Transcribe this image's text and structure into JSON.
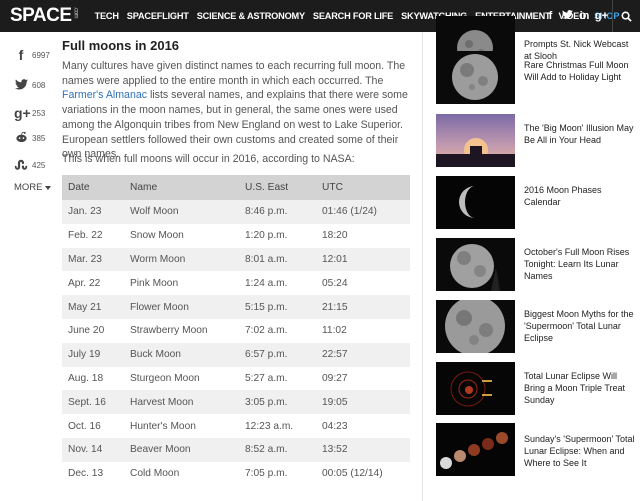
{
  "header": {
    "logo": "SPACE",
    "logo_suffix": ".com",
    "nav": [
      "TECH",
      "SPACEFLIGHT",
      "SCIENCE & ASTRONOMY",
      "SEARCH FOR LIFE",
      "SKYWATCHING",
      "ENTERTAINMENT",
      "VIDEO",
      "SHOP"
    ],
    "social": [
      "f",
      "t",
      "in",
      "g+"
    ],
    "search_icon": "search-icon"
  },
  "share": {
    "facebook": "6997",
    "twitter": "608",
    "googleplus": "253",
    "reddit": "385",
    "stumbleupon": "425",
    "more": "MORE"
  },
  "article": {
    "title": "Full moons in 2016",
    "intro_before": "Many cultures have given distinct names to each recurring full moon. The names were applied to the entire month in which each occurred. The ",
    "intro_link": "Farmer's Almanac",
    "intro_after": " lists several names, and explains that there were some variations in the moon names, but in general, the same ones were used among the Algonquin tribes from New England on west to Lake Superior. European settlers followed their own customs and created some of their own names.",
    "nasa_line": "This is when full moons will occur in 2016, according to NASA:",
    "table": {
      "headers": [
        "Date",
        "Name",
        "U.S. East",
        "UTC"
      ],
      "rows": [
        [
          "Jan. 23",
          "Wolf Moon",
          "8:46 p.m.",
          "01:46 (1/24)"
        ],
        [
          "Feb. 22",
          "Snow Moon",
          "1:20 p.m.",
          "18:20"
        ],
        [
          "Mar. 23",
          "Worm Moon",
          "8:01 a.m.",
          "12:01"
        ],
        [
          "Apr. 22",
          "Pink Moon",
          "1:24 a.m.",
          "05:24"
        ],
        [
          "May 21",
          "Flower Moon",
          "5:15 p.m.",
          "21:15"
        ],
        [
          "June 20",
          "Strawberry Moon",
          "7:02 a.m.",
          "11:02"
        ],
        [
          "July 19",
          "Buck Moon",
          "6:57 p.m.",
          "22:57"
        ],
        [
          "Aug. 18",
          "Sturgeon Moon",
          "5:27 a.m.",
          "09:27"
        ],
        [
          "Sept. 16",
          "Harvest Moon",
          "3:05 p.m.",
          "19:05"
        ],
        [
          "Oct. 16",
          "Hunter's Moon",
          "12:23 a.m.",
          "04:23"
        ],
        [
          "Nov. 14",
          "Beaver Moon",
          "8:52 a.m.",
          "13:52"
        ],
        [
          "Dec. 13",
          "Cold Moon",
          "7:05 p.m.",
          "00:05 (12/14)"
        ]
      ]
    }
  },
  "sidebar": {
    "items": [
      {
        "title": "Prompts St. Nick Webcast at Slooh"
      },
      {
        "title": "Rare Christmas Full Moon Will Add to Holiday Light"
      },
      {
        "title": "The 'Big Moon' Illusion May Be All in Your Head"
      },
      {
        "title": "2016 Moon Phases Calendar"
      },
      {
        "title": "October's Full Moon Rises Tonight: Learn Its Lunar Names"
      },
      {
        "title": "Biggest Moon Myths for the 'Supermoon' Total Lunar Eclipse"
      },
      {
        "title": "Total Lunar Eclipse Will Bring a Moon Triple Treat Sunday"
      },
      {
        "title": "Sunday's 'Supermoon' Total Lunar Eclipse: When and Where to See It"
      }
    ]
  }
}
